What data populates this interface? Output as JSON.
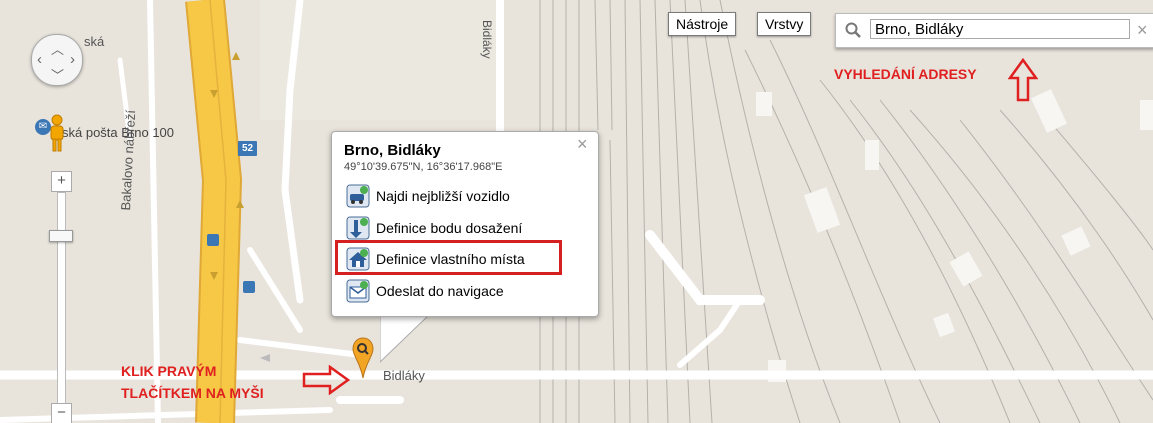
{
  "map": {
    "streets": {
      "main_west": "Bakalovo nábřeží",
      "bidlaky_vertical": "Bidláky",
      "bidlaky_bottom": "Bidláky",
      "top_left": "ská",
      "post_office": "ská pošta Brno 100"
    },
    "road_shield": "52"
  },
  "toolbar": {
    "tools_label": "Nástroje",
    "layers_label": "Vrstvy"
  },
  "search": {
    "value": "Brno, Bidláky",
    "clear_glyph": "×"
  },
  "zoom": {
    "plus": "+",
    "minus": "−"
  },
  "popup": {
    "title": "Brno, Bidláky",
    "coords": "49°10'39.675\"N, 16°36'17.968\"E",
    "close_glyph": "×",
    "items": [
      {
        "label": "Najdi nejbližší vozidlo",
        "icon": "vehicle-icon"
      },
      {
        "label": "Definice bodu dosažení",
        "icon": "target-point-icon"
      },
      {
        "label": "Definice vlastního místa",
        "icon": "home-icon"
      },
      {
        "label": "Odeslat do navigace",
        "icon": "send-navigation-icon"
      }
    ]
  },
  "annotations": {
    "search_note": "VYHLEDÁNÍ ADRESY",
    "click_note_line1": "KLIK PRAVÝM",
    "click_note_line2": "TLAČÍTKEM NA MYŠI"
  },
  "colors": {
    "accent_red": "#e02020",
    "road_yellow": "#f6c846",
    "map_bg": "#e8e4dc"
  }
}
